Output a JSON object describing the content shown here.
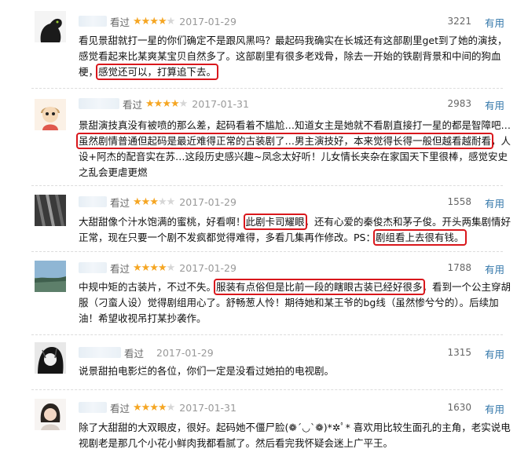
{
  "comments": [
    {
      "status": "看过",
      "rating": 4,
      "stars_filled": "★★★★",
      "stars_empty": "★",
      "date": "2017-01-29",
      "votes": "3221",
      "useful_label": "有用",
      "lines": [
        [
          "看见景甜就打一星的你们确定不是跟风黑吗？最起码我确实在长城还有这部剧里get到了她的演技，"
        ],
        [
          "感觉看起来比某爽某宝贝自然多了。这部剧里有很多老戏骨，除去一开始的铁剧背景和中间的狗血"
        ],
        [
          "梗，",
          "感觉还可以，打算追下去。"
        ]
      ]
    },
    {
      "status": "看过",
      "rating": 4,
      "stars_filled": "★★★★",
      "stars_empty": "★",
      "date": "2017-01-31",
      "votes": "2983",
      "useful_label": "有用",
      "lines": [
        [
          "景甜演技真没有被喷的那么差，起码看着不尴尬…知道女主是她就不看剧直接打一星的都是智障吧…"
        ],
        [
          "虽然剧情普通但起码是最近难得正常的古装剧了…男主演技好，本来觉得长得一般但越看越耐看",
          "，人"
        ],
        [
          "设+阿杰的配音实在苏…这段历史感兴趣~凤念太好听！儿女情长夹杂在家国天下里很棒，感觉安史"
        ],
        [
          "之乱会更虐更燃"
        ]
      ]
    },
    {
      "status": "看过",
      "rating": 3,
      "stars_filled": "★★★",
      "stars_empty": "★★",
      "date": "2017-01-29",
      "votes": "1558",
      "useful_label": "有用",
      "lines": [
        [
          "大甜甜像个汁水饱满的蜜桃，好看啊！",
          "此剧卡司耀眼",
          "，还有心爱的秦俊杰和茅子俊。开头两集剧情好"
        ],
        [
          "正常，现在只要一个剧不发疯都觉得难得，多看几集再作修改。PS：",
          "剧组看上去很有钱。"
        ]
      ]
    },
    {
      "status": "看过",
      "rating": 4,
      "stars_filled": "★★★★",
      "stars_empty": "★",
      "date": "2017-01-29",
      "votes": "1788",
      "useful_label": "有用",
      "lines": [
        [
          "中规中矩的古装片，不过不失。",
          "服装有点俗但是比前一段的瞎眼古装已经好很多",
          "，看到一个公主穿胡"
        ],
        [
          "服（刁蛮人设）觉得剧组用心了。舒畅葱人怜！期待她和某王爷的bg线（虽然惨兮兮的）。后续加"
        ],
        [
          "油！希望收视吊打某抄袭作。"
        ]
      ]
    },
    {
      "status": "看过",
      "rating": 0,
      "stars_filled": "",
      "stars_empty": "",
      "date": "2017-01-29",
      "votes": "1315",
      "useful_label": "有用",
      "lines": [
        [
          "说景甜拍电影烂的各位，你们一定是没看过她拍的电视剧。"
        ]
      ]
    },
    {
      "status": "看过",
      "rating": 4,
      "stars_filled": "★★★★",
      "stars_empty": "★",
      "date": "2017-01-31",
      "votes": "1630",
      "useful_label": "有用",
      "lines": [
        [
          "除了大甜甜的大双眼皮，很好。起码她不僵尸脸(❁´◡`❁)*✲ﾟ* 喜欢用比较生面孔的主角，老实说电"
        ],
        [
          "视剧老是那几个小花小鲜肉我都看腻了。然后看完我怀疑会迷上广平王。"
        ]
      ]
    }
  ]
}
